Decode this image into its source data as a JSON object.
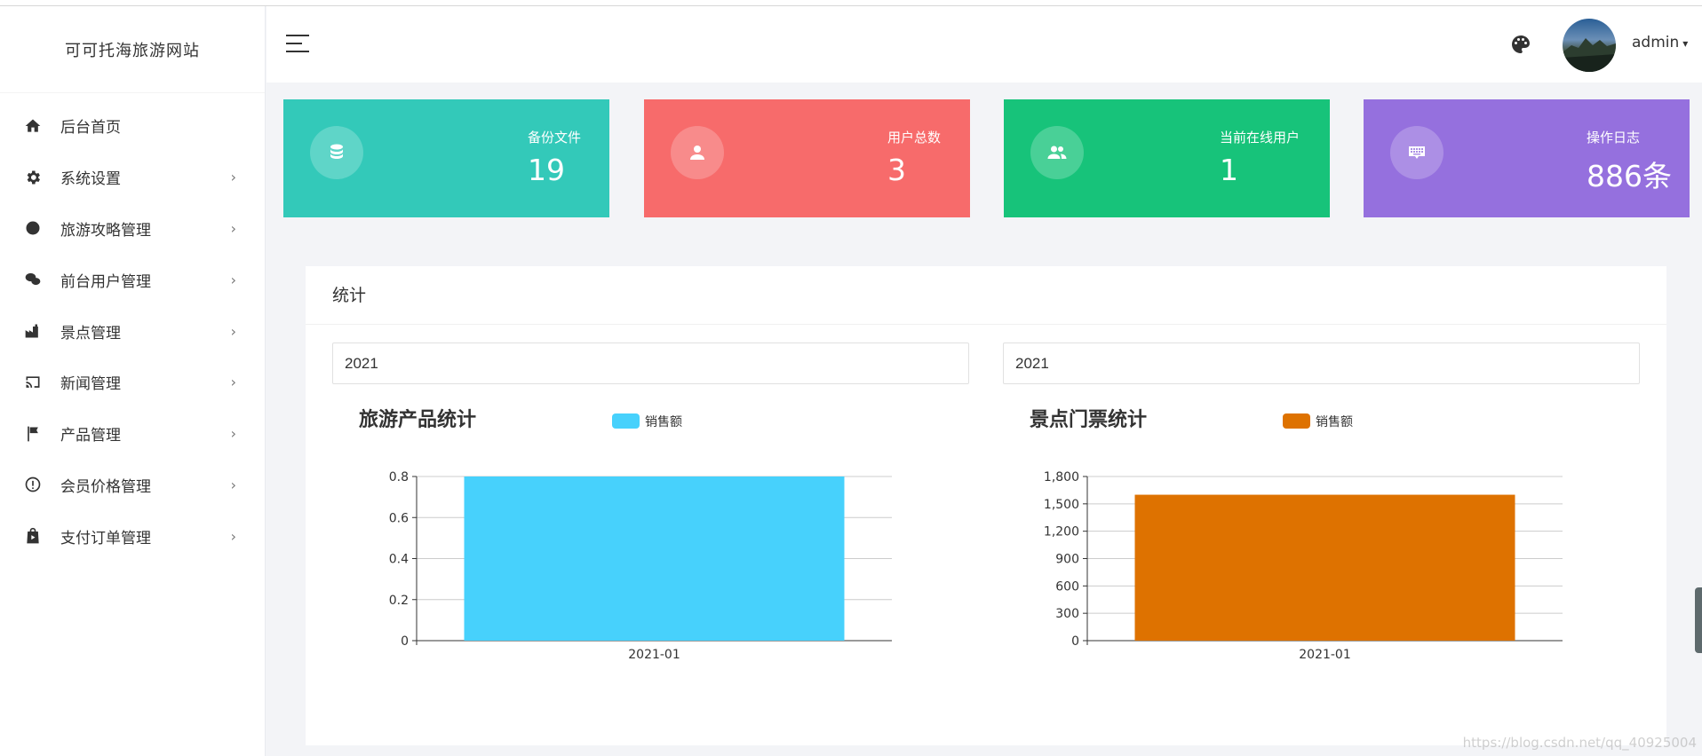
{
  "app": {
    "title": "可可托海旅游网站"
  },
  "sidebar": {
    "items": [
      {
        "label": "后台首页",
        "icon": "home-icon",
        "has_children": false
      },
      {
        "label": "系统设置",
        "icon": "gear-icon",
        "has_children": true
      },
      {
        "label": "旅游攻略管理",
        "icon": "circle-icon",
        "has_children": true
      },
      {
        "label": "前台用户管理",
        "icon": "wechat-icon",
        "has_children": true
      },
      {
        "label": "景点管理",
        "icon": "factory-icon",
        "has_children": true
      },
      {
        "label": "新闻管理",
        "icon": "cast-icon",
        "has_children": true
      },
      {
        "label": "产品管理",
        "icon": "flag-icon",
        "has_children": true
      },
      {
        "label": "会员价格管理",
        "icon": "alert-circle-icon",
        "has_children": true
      },
      {
        "label": "支付订单管理",
        "icon": "shopping-bag-icon",
        "has_children": true
      }
    ],
    "chevron": "›"
  },
  "header": {
    "username": "admin",
    "caret": "▾"
  },
  "stats": [
    {
      "title": "备份文件",
      "value": "19",
      "color": "#33c9b9",
      "icon": "database-icon"
    },
    {
      "title": "用户总数",
      "value": "3",
      "color": "#f76b6b",
      "icon": "user-icon"
    },
    {
      "title": "当前在线用户",
      "value": "1",
      "color": "#17c37a",
      "icon": "users-icon"
    },
    {
      "title": "操作日志",
      "value": "886条",
      "color": "#9570de",
      "icon": "keyboard-icon"
    }
  ],
  "panel": {
    "title": "统计",
    "left_select": "2021",
    "right_select": "2021"
  },
  "chart_data": [
    {
      "type": "bar",
      "title": "旅游产品统计",
      "categories": [
        "2021-01"
      ],
      "series": [
        {
          "name": "销售额",
          "values": [
            0.8
          ],
          "color": "#47d1fc"
        }
      ],
      "ylim": [
        0,
        0.8
      ],
      "yticks": [
        "0",
        "0.2",
        "0.4",
        "0.6",
        "0.8"
      ],
      "grid": true,
      "legend": "top"
    },
    {
      "type": "bar",
      "title": "景点门票统计",
      "categories": [
        "2021-01"
      ],
      "series": [
        {
          "name": "销售额",
          "values": [
            1600
          ],
          "color": "#de7200"
        }
      ],
      "ylim": [
        0,
        1800
      ],
      "yticks": [
        "0",
        "300",
        "600",
        "900",
        "1,200",
        "1,500",
        "1,800"
      ],
      "grid": true,
      "legend": "top"
    }
  ],
  "watermark": "https://blog.csdn.net/qq_40925004"
}
